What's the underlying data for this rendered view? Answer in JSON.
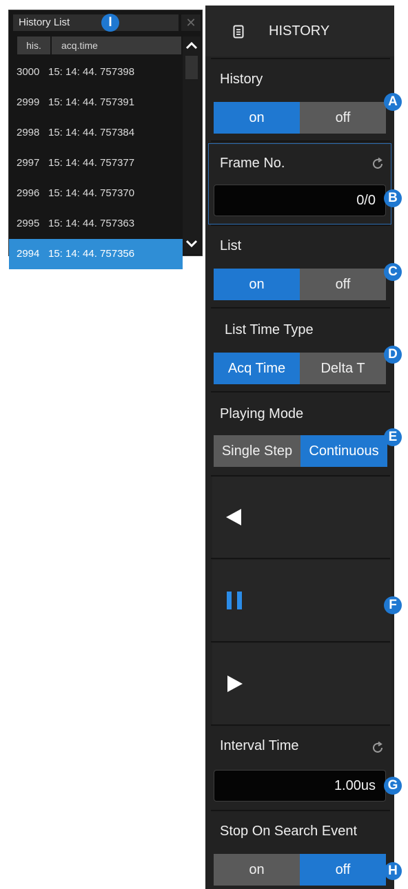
{
  "history_list": {
    "title": "History List",
    "close_icon": "close-icon",
    "columns": {
      "his": "his.",
      "acq": "acq.time"
    },
    "rows": [
      {
        "his": "3000",
        "time": "15: 14: 44. 757398",
        "selected": false
      },
      {
        "his": "2999",
        "time": "15: 14: 44. 757391",
        "selected": false
      },
      {
        "his": "2998",
        "time": "15: 14: 44. 757384",
        "selected": false
      },
      {
        "his": "2997",
        "time": "15: 14: 44. 757377",
        "selected": false
      },
      {
        "his": "2996",
        "time": "15: 14: 44. 757370",
        "selected": false
      },
      {
        "his": "2995",
        "time": "15: 14: 44. 757363",
        "selected": false
      },
      {
        "his": "2994",
        "time": "15: 14: 44. 757356",
        "selected": true
      }
    ],
    "badge": "I"
  },
  "menu": {
    "title": "HISTORY",
    "history": {
      "label": "History",
      "on": "on",
      "off": "off",
      "selected": "on",
      "badge": "A"
    },
    "frame_no": {
      "label": "Frame No.",
      "value": "0/0",
      "badge": "B"
    },
    "list": {
      "label": "List",
      "on": "on",
      "off": "off",
      "selected": "on",
      "badge": "C"
    },
    "list_time_type": {
      "label": "List Time Type",
      "opt1": "Acq Time",
      "opt2": "Delta T",
      "selected": "Acq Time",
      "badge": "D"
    },
    "playing_mode": {
      "label": "Playing Mode",
      "opt1": "Single Step",
      "opt2": "Continuous",
      "selected": "Continuous",
      "badge": "E"
    },
    "controls": {
      "back_icon": "play-backward-icon",
      "pause_icon": "pause-icon",
      "forward_icon": "play-forward-icon",
      "badge": "F"
    },
    "interval_time": {
      "label": "Interval Time",
      "value": "1.00us",
      "badge": "G"
    },
    "stop_on_search": {
      "label": "Stop On Search Event",
      "on": "on",
      "off": "off",
      "selected": "off",
      "badge": "H"
    }
  },
  "colors": {
    "accent": "#1f78d1",
    "selected_row": "#2f8ed6",
    "panel_bg": "#222222",
    "inactive_option": "#5a5a5a"
  }
}
